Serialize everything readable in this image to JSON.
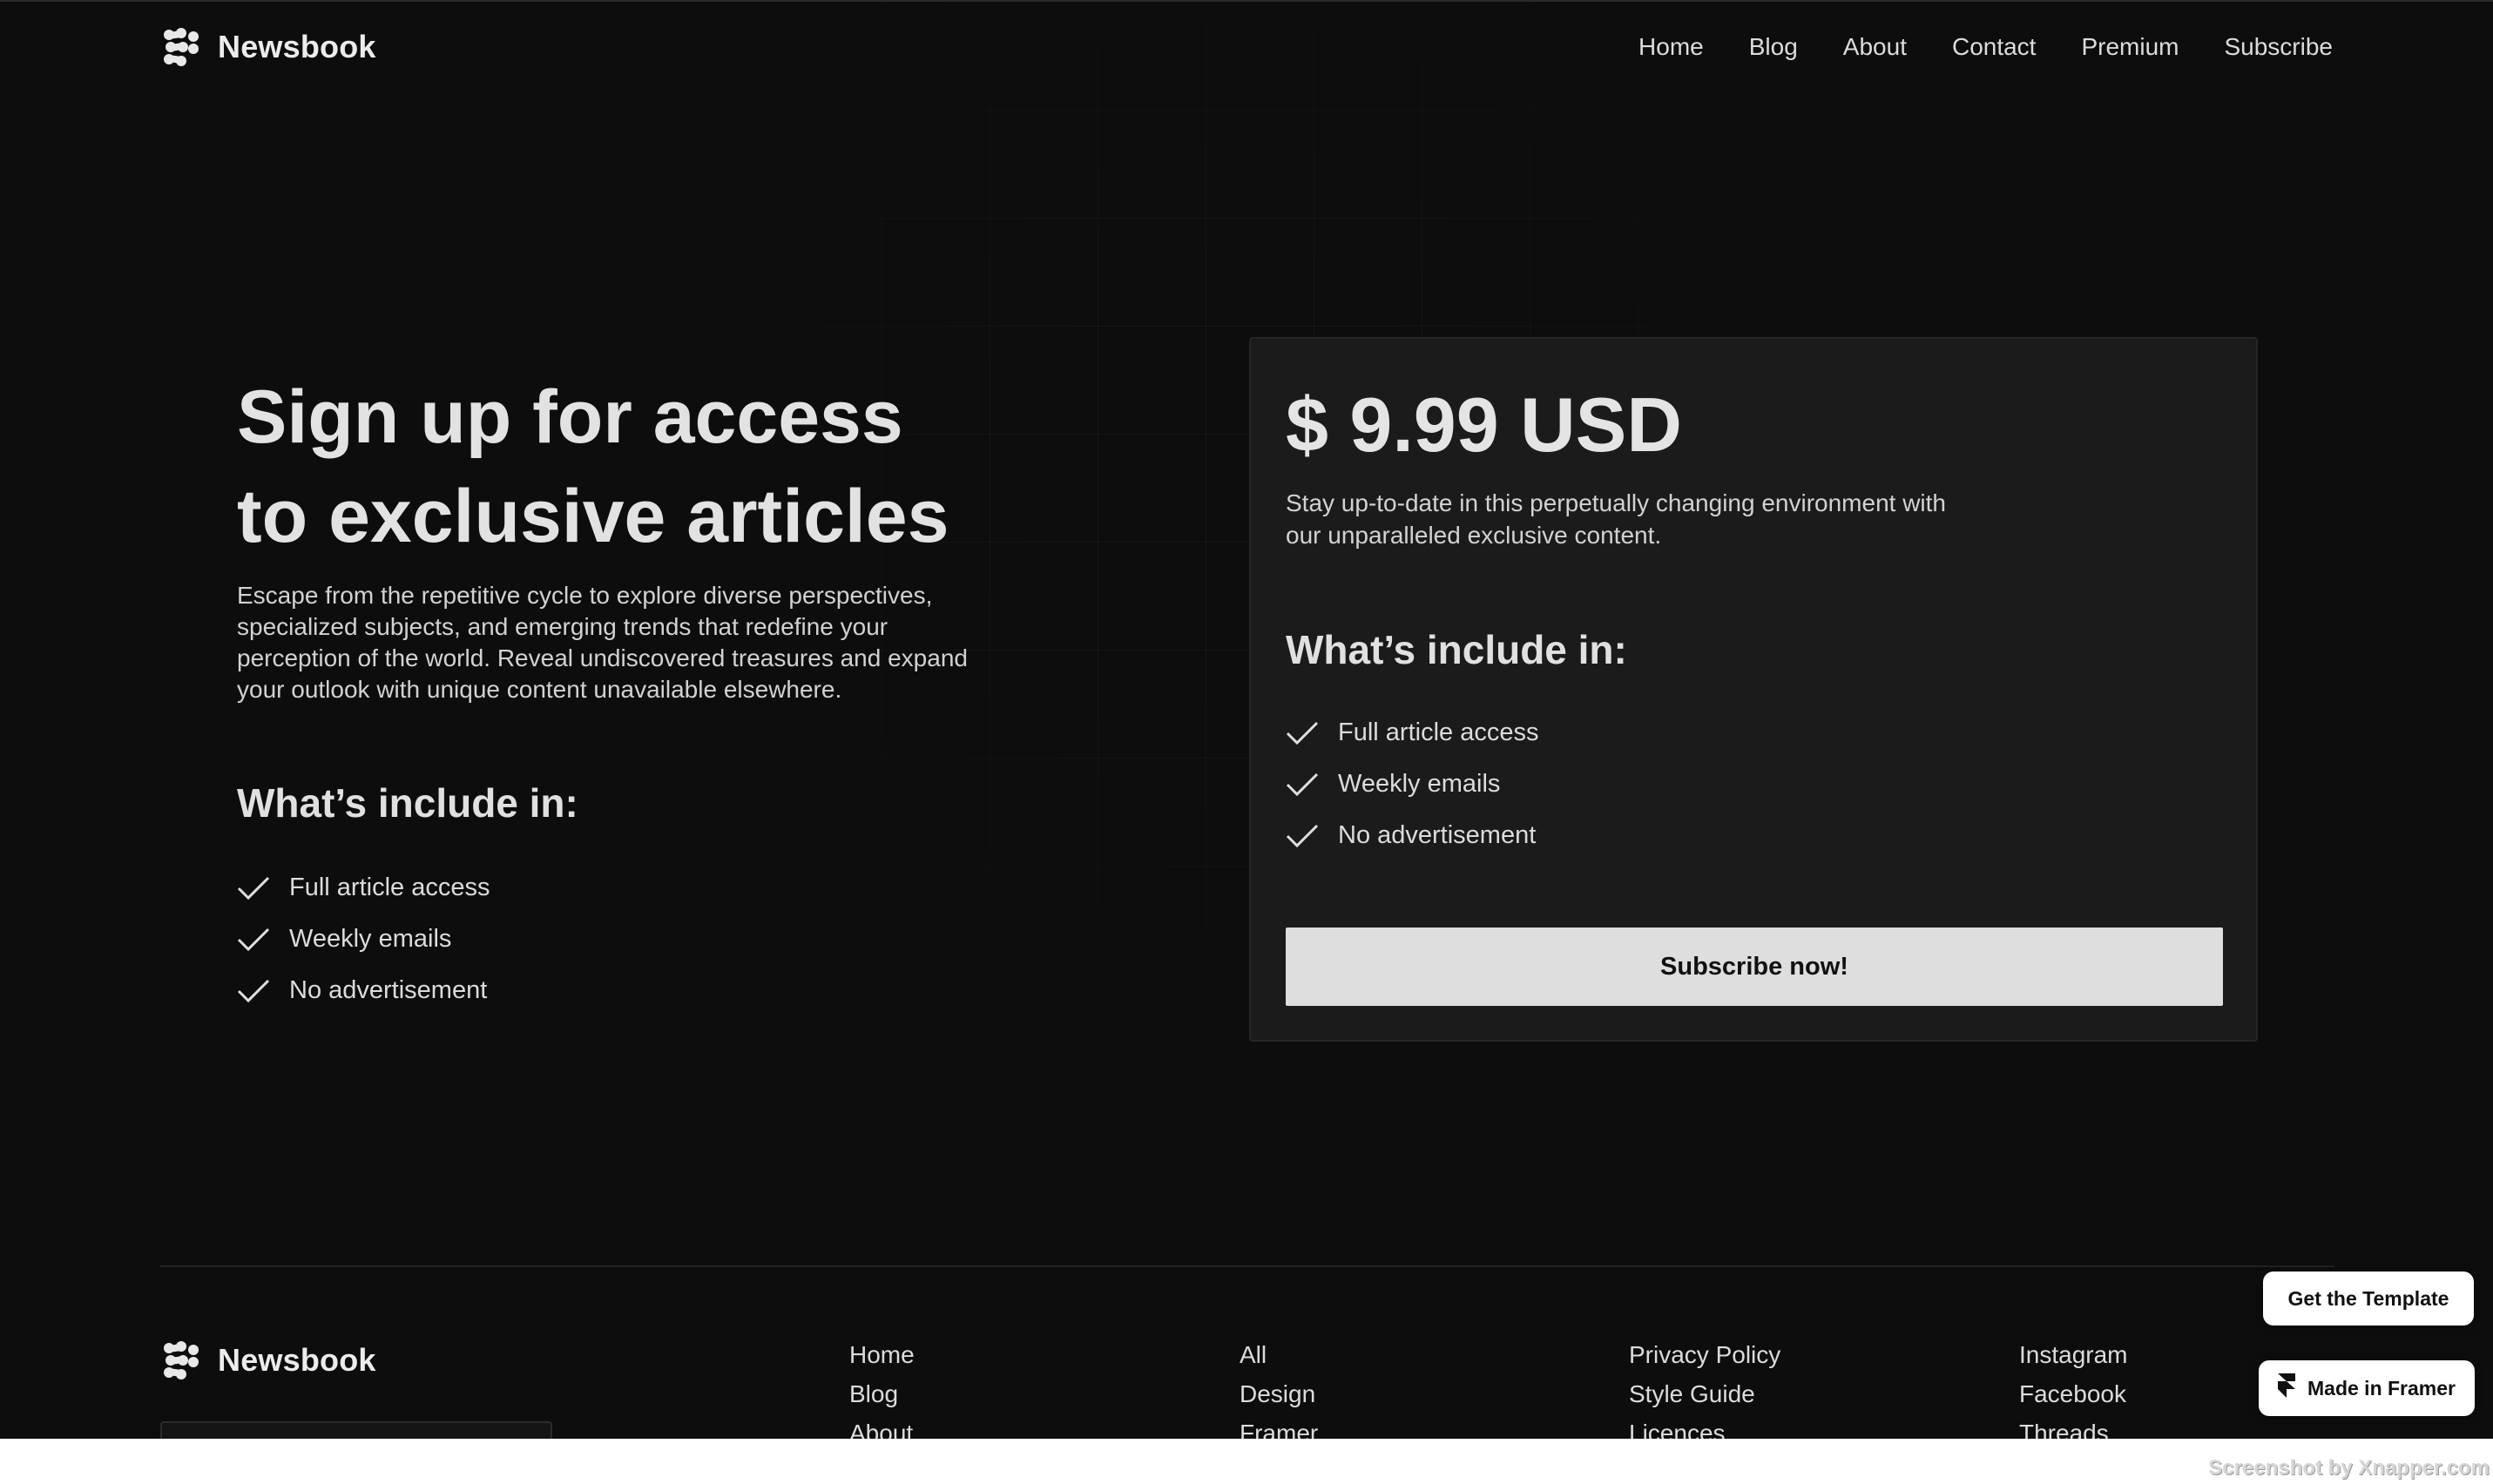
{
  "header": {
    "brand": "Newsbook",
    "nav": [
      "Home",
      "Blog",
      "About",
      "Contact",
      "Premium",
      "Subscribe"
    ]
  },
  "hero": {
    "title_line1": "Sign up for access",
    "title_line2": "to exclusive articles",
    "description": "Escape from the repetitive cycle to explore diverse perspectives, specialized subjects, and emerging trends that redefine your perception of the world. Reveal undiscovered treasures and expand your outlook with unique content unavailable elsewhere.",
    "includes_heading": "What’s include in:",
    "features": [
      "Full article access",
      "Weekly emails",
      "No advertisement"
    ]
  },
  "pricing_card": {
    "price": "$ 9.99 USD",
    "description": "Stay up-to-date in this perpetually changing environment with our unparalleled exclusive content.",
    "includes_heading": "What’s include in:",
    "features": [
      "Full article access",
      "Weekly emails",
      "No advertisement"
    ],
    "button_label": "Subscribe now!"
  },
  "footer": {
    "brand": "Newsbook",
    "columns": [
      [
        "Home",
        "Blog",
        "About"
      ],
      [
        "All",
        "Design",
        "Framer"
      ],
      [
        "Privacy Policy",
        "Style Guide",
        "Licences"
      ],
      [
        "Instagram",
        "Facebook",
        "Threads"
      ]
    ]
  },
  "floating": {
    "get_template": "Get the Template",
    "made_in_framer": "Made in Framer"
  },
  "watermark": "Screenshot by Xnapper.com",
  "colors": {
    "background": "#0d0d0d",
    "card": "#1b1b1b",
    "button": "#dedede",
    "text": "#e6e6e6"
  },
  "icons": {
    "brand_logo": "newsbook-logo-icon",
    "check": "check-icon",
    "framer": "framer-icon"
  }
}
